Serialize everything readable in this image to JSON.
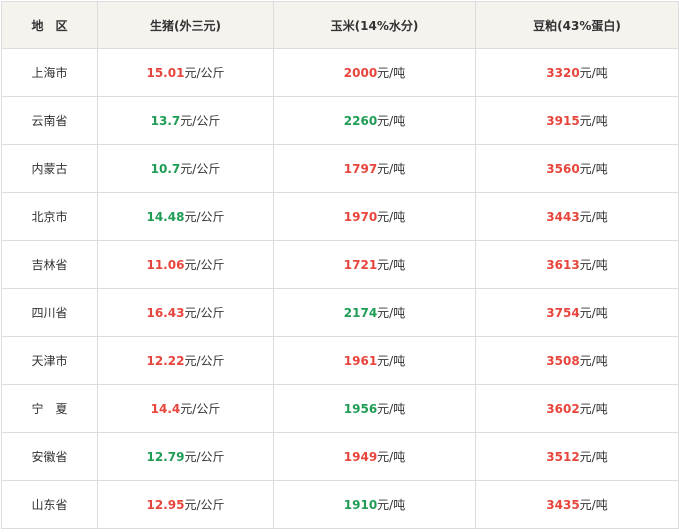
{
  "header": {
    "region": "地　区",
    "pig": "生猪(外三元)",
    "corn": "玉米(14%水分)",
    "soy": "豆粕(43%蛋白)"
  },
  "units": {
    "per_kg": "元/公斤",
    "per_ton": "元/吨"
  },
  "colors": {
    "up": "#e8453c",
    "down": "#1f9d55",
    "header_bg": "#f6f3ef",
    "border": "#dcdcdc"
  },
  "rows": [
    {
      "region": "上海市",
      "pig": "15.01",
      "pig_trend": "up",
      "corn": "2000",
      "corn_trend": "up",
      "soy": "3320",
      "soy_trend": "up"
    },
    {
      "region": "云南省",
      "pig": "13.7",
      "pig_trend": "down",
      "corn": "2260",
      "corn_trend": "down",
      "soy": "3915",
      "soy_trend": "up"
    },
    {
      "region": "内蒙古",
      "pig": "10.7",
      "pig_trend": "down",
      "corn": "1797",
      "corn_trend": "up",
      "soy": "3560",
      "soy_trend": "up"
    },
    {
      "region": "北京市",
      "pig": "14.48",
      "pig_trend": "down",
      "corn": "1970",
      "corn_trend": "up",
      "soy": "3443",
      "soy_trend": "up"
    },
    {
      "region": "吉林省",
      "pig": "11.06",
      "pig_trend": "up",
      "corn": "1721",
      "corn_trend": "up",
      "soy": "3613",
      "soy_trend": "up"
    },
    {
      "region": "四川省",
      "pig": "16.43",
      "pig_trend": "up",
      "corn": "2174",
      "corn_trend": "down",
      "soy": "3754",
      "soy_trend": "up"
    },
    {
      "region": "天津市",
      "pig": "12.22",
      "pig_trend": "up",
      "corn": "1961",
      "corn_trend": "up",
      "soy": "3508",
      "soy_trend": "up"
    },
    {
      "region": "宁　夏",
      "pig": "14.4",
      "pig_trend": "up",
      "corn": "1956",
      "corn_trend": "down",
      "soy": "3602",
      "soy_trend": "up"
    },
    {
      "region": "安徽省",
      "pig": "12.79",
      "pig_trend": "down",
      "corn": "1949",
      "corn_trend": "up",
      "soy": "3512",
      "soy_trend": "up"
    },
    {
      "region": "山东省",
      "pig": "12.95",
      "pig_trend": "up",
      "corn": "1910",
      "corn_trend": "down",
      "soy": "3435",
      "soy_trend": "up"
    }
  ]
}
